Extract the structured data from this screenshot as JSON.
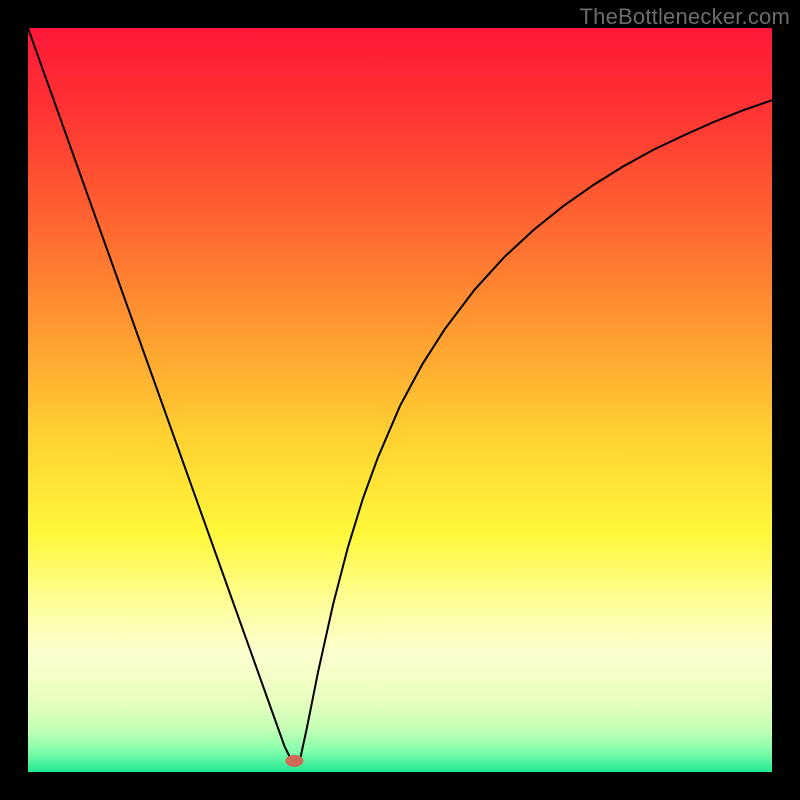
{
  "watermark": "TheBottlenecker.com",
  "chart_data": {
    "type": "line",
    "title": "",
    "xlabel": "",
    "ylabel": "",
    "xlim": [
      0,
      1
    ],
    "ylim": [
      0,
      1
    ],
    "background": {
      "type": "vertical-gradient",
      "stops": [
        {
          "offset": 0.0,
          "color": "#ff1838"
        },
        {
          "offset": 0.1,
          "color": "#ff3033"
        },
        {
          "offset": 0.25,
          "color": "#ff6131"
        },
        {
          "offset": 0.4,
          "color": "#ff9831"
        },
        {
          "offset": 0.55,
          "color": "#ffd231"
        },
        {
          "offset": 0.68,
          "color": "#fff83a"
        },
        {
          "offset": 0.78,
          "color": "#ffffa0"
        },
        {
          "offset": 0.84,
          "color": "#fdffd0"
        },
        {
          "offset": 0.9,
          "color": "#eaffc0"
        },
        {
          "offset": 0.94,
          "color": "#c7ffb6"
        },
        {
          "offset": 0.97,
          "color": "#88ffad"
        },
        {
          "offset": 1.0,
          "color": "#20e891"
        }
      ]
    },
    "marker": {
      "x": 0.358,
      "y": 0.015,
      "color": "#cf6a58",
      "rx": 9,
      "ry": 6
    },
    "series": [
      {
        "name": "curve",
        "color": "#000000",
        "width": 2,
        "x": [
          0.0,
          0.02,
          0.04,
          0.06,
          0.08,
          0.1,
          0.12,
          0.14,
          0.16,
          0.18,
          0.2,
          0.22,
          0.24,
          0.26,
          0.28,
          0.3,
          0.32,
          0.335,
          0.345,
          0.355,
          0.365,
          0.375,
          0.39,
          0.41,
          0.43,
          0.45,
          0.47,
          0.5,
          0.53,
          0.56,
          0.6,
          0.64,
          0.68,
          0.72,
          0.76,
          0.8,
          0.84,
          0.88,
          0.92,
          0.96,
          1.0
        ],
        "y": [
          1.0,
          0.944,
          0.888,
          0.832,
          0.776,
          0.72,
          0.664,
          0.608,
          0.552,
          0.496,
          0.44,
          0.384,
          0.328,
          0.272,
          0.216,
          0.16,
          0.104,
          0.062,
          0.034,
          0.014,
          0.014,
          0.06,
          0.135,
          0.225,
          0.302,
          0.367,
          0.422,
          0.492,
          0.548,
          0.595,
          0.648,
          0.692,
          0.729,
          0.761,
          0.789,
          0.814,
          0.836,
          0.855,
          0.873,
          0.889,
          0.903
        ]
      }
    ]
  }
}
